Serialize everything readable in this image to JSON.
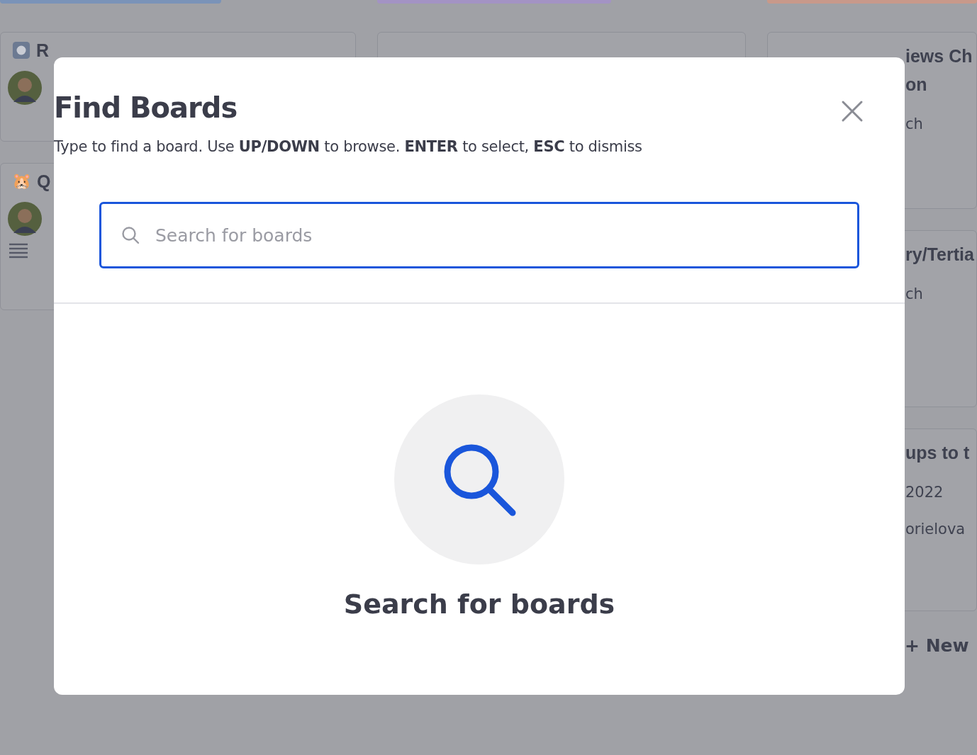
{
  "board": {
    "columns": [
      {
        "color": "#7a93b8",
        "cards": [
          {
            "kind": "icon",
            "title": "R",
            "avatar": true,
            "list": false
          },
          {
            "kind": "emoji",
            "emoji": "🐹",
            "title": "Q",
            "avatar": true,
            "list": true
          }
        ]
      },
      {
        "color": "#a393c4",
        "cards": [
          {
            "kind": "blank"
          }
        ]
      },
      {
        "color": "#c8998a",
        "cards": [
          {
            "kind": "fragment",
            "lines": [
              "iews Ch",
              "on"
            ],
            "meta": [
              "ch"
            ]
          },
          {
            "kind": "fragment",
            "lines": [
              "ry/Tertia"
            ],
            "meta": [
              "ch"
            ]
          },
          {
            "kind": "fragment",
            "lines": [
              "ups to t"
            ],
            "meta": [
              "2022",
              "orielova"
            ]
          }
        ],
        "add_label": "+ New"
      }
    ]
  },
  "dialog": {
    "title": "Find Boards",
    "subtitle": "Type to find a board. Use **UP/DOWN** to browse. **ENTER** to select, **ESC** to dismiss",
    "search": {
      "placeholder": "Search for boards",
      "focused": true
    },
    "empty_state": {
      "message": "Search for boards"
    }
  }
}
